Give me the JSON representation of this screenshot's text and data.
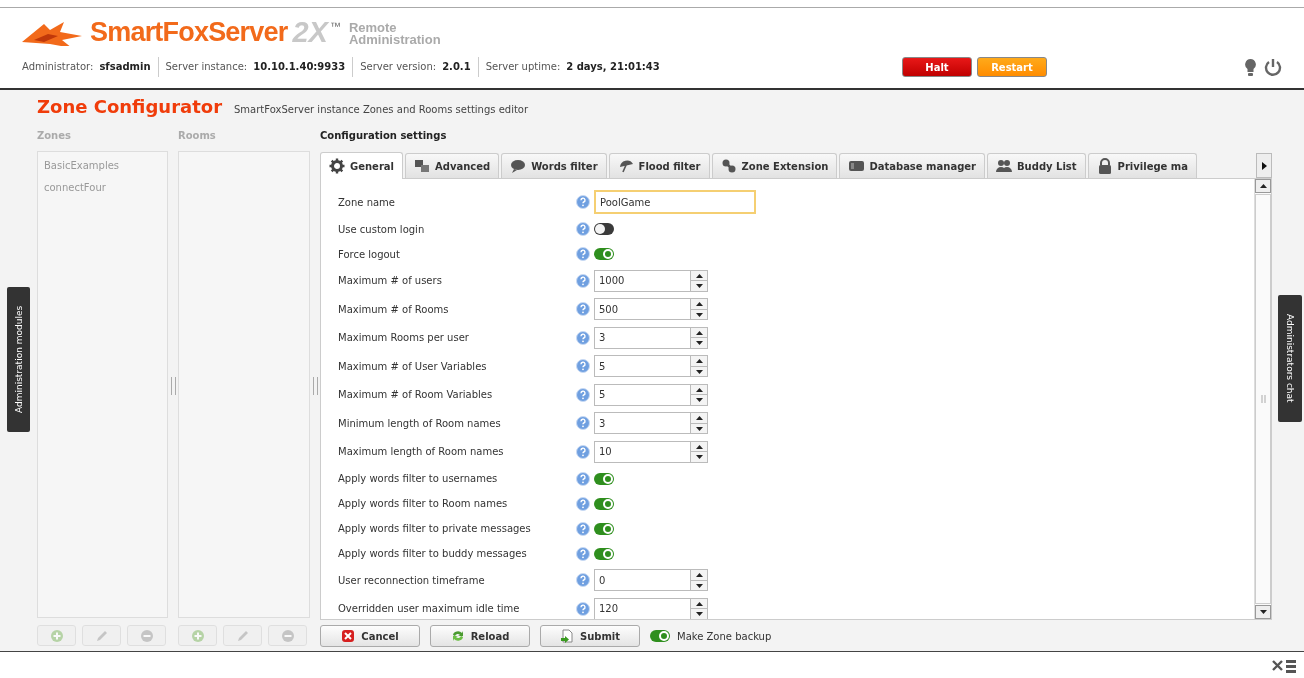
{
  "header": {
    "logo": {
      "brand": "SmartFoxServer",
      "version": "2X",
      "trademark": "™",
      "subtitle": [
        "Remote",
        "Administration"
      ]
    },
    "info": [
      {
        "label": "Administrator:",
        "value": "sfsadmin"
      },
      {
        "label": "Server instance:",
        "value": "10.10.1.40:9933"
      },
      {
        "label": "Server version:",
        "value": "2.0.1"
      },
      {
        "label": "Server uptime:",
        "value": "2 days, 21:01:43"
      }
    ],
    "buttons": [
      {
        "label": "Halt",
        "kind": "danger"
      },
      {
        "label": "Restart",
        "kind": "warning"
      }
    ]
  },
  "side_tabs": {
    "left": "Administration modules",
    "right": "Administrators chat"
  },
  "module": {
    "title": "Zone Configurator",
    "subtitle": "SmartFoxServer instance Zones and Rooms settings editor"
  },
  "zones": {
    "heading": "Zones",
    "items": [
      "BasicExamples",
      "connectFour"
    ],
    "buttons_disabled": true
  },
  "rooms": {
    "heading": "Rooms",
    "buttons_disabled": true
  },
  "config": {
    "heading": "Configuration settings",
    "tabs": [
      {
        "label": "General",
        "selected": true
      },
      {
        "label": "Advanced",
        "selected": false
      },
      {
        "label": "Words filter",
        "selected": false
      },
      {
        "label": "Flood filter",
        "selected": false
      },
      {
        "label": "Zone Extension",
        "selected": false
      },
      {
        "label": "Database manager",
        "selected": false
      },
      {
        "label": "Buddy List",
        "selected": false
      },
      {
        "label": "Privilege ma",
        "selected": false
      }
    ],
    "fields": [
      {
        "label": "Zone name",
        "kind": "text",
        "value": "PoolGame"
      },
      {
        "label": "Use custom login",
        "kind": "toggle",
        "on": false
      },
      {
        "label": "Force logout",
        "kind": "toggle",
        "on": true
      },
      {
        "label": "Maximum # of users",
        "kind": "spinner",
        "value": "1000"
      },
      {
        "label": "Maximum # of Rooms",
        "kind": "spinner",
        "value": "500"
      },
      {
        "label": "Maximum Rooms per user",
        "kind": "spinner",
        "value": "3"
      },
      {
        "label": "Maximum # of User Variables",
        "kind": "spinner",
        "value": "5"
      },
      {
        "label": "Maximum # of Room Variables",
        "kind": "spinner",
        "value": "5"
      },
      {
        "label": "Minimum length of Room names",
        "kind": "spinner",
        "value": "3"
      },
      {
        "label": "Maximum length of Room names",
        "kind": "spinner",
        "value": "10"
      },
      {
        "label": "Apply words filter to usernames",
        "kind": "toggle",
        "on": true
      },
      {
        "label": "Apply words filter to Room names",
        "kind": "toggle",
        "on": true
      },
      {
        "label": "Apply words filter to private messages",
        "kind": "toggle",
        "on": true
      },
      {
        "label": "Apply words filter to buddy messages",
        "kind": "toggle",
        "on": true
      },
      {
        "label": "User reconnection timeframe",
        "kind": "spinner",
        "value": "0"
      },
      {
        "label": "Overridden user maximum idle time",
        "kind": "spinner",
        "value": "120"
      }
    ],
    "buttons": [
      "Cancel",
      "Reload",
      "Submit"
    ],
    "backup": {
      "label": "Make Zone backup",
      "on": true
    }
  }
}
